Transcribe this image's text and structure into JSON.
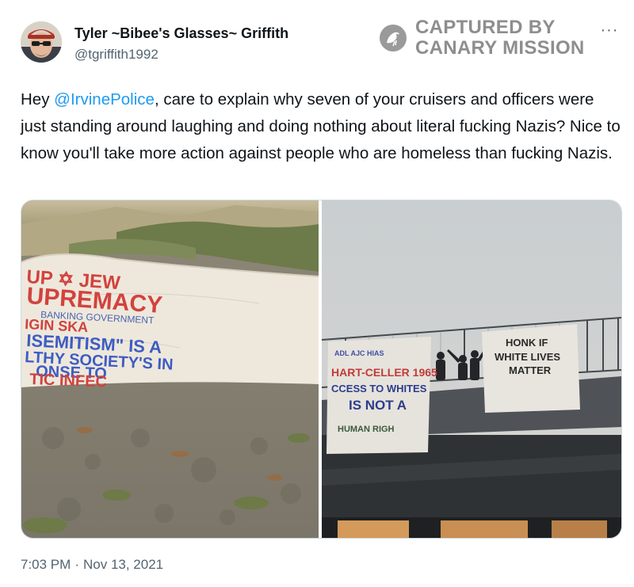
{
  "user": {
    "display_name": "Tyler ~Bibee's Glasses~ Griffith",
    "handle": "@tgriffith1992"
  },
  "watermark": {
    "line1": "CAPTURED BY",
    "line2": "CANARY MISSION",
    "icon": "canary-bird-icon"
  },
  "more_label": "···",
  "tweet": {
    "prefix": "Hey ",
    "mention": "@IrvinePolice",
    "body": ", care to explain why seven of your cruisers and officers were just standing around laughing and doing nothing about literal fucking Nazis? Nice to know you'll take more action against people who are homeless than fucking Nazis."
  },
  "media": {
    "left_banner": {
      "line1": "UP  ✡  JEW",
      "line2": "UPREMACY",
      "line3": "BANKING  GOVERNMENT",
      "line4": "IGIN   SKA",
      "line5": "ISEMITISM\"  IS A",
      "line6": "LTHY  SOCIETY'S  IN",
      "line7": "ONSE  TO",
      "line8": "TIC  INFEC"
    },
    "right_banner_left": {
      "line1": "ADL  AJC  HIAS",
      "line2": "HART-CELLER 1965",
      "line3": "CCESS TO WHITES",
      "line4": "IS NOT A",
      "line5": "HUMAN RIGH"
    },
    "right_banner_right": {
      "line1": "HONK  IF",
      "line2": "WHITE LIVES",
      "line3": "MATTER"
    }
  },
  "footer": {
    "time": "7:03 PM",
    "separator": "·",
    "date": "Nov 13, 2021"
  },
  "colors": {
    "link": "#1d9bf0",
    "secondary_text": "#536471",
    "primary_text": "#0f1419",
    "watermark": "#8e8e8e"
  }
}
